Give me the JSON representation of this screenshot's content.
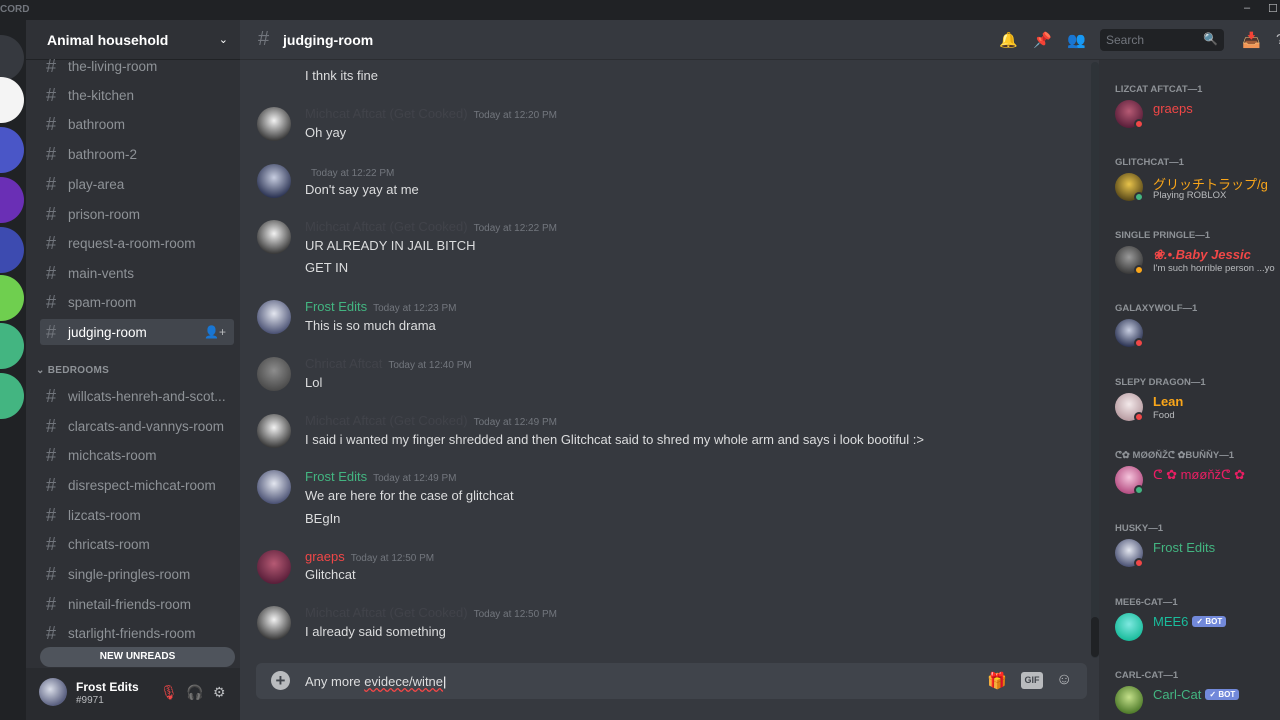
{
  "titlebar": {
    "brand": "CORD",
    "min": "–",
    "max": "☐"
  },
  "server": {
    "name": "Animal household",
    "chevron": "⌄"
  },
  "channels": [
    {
      "label": "the-living-room"
    },
    {
      "label": "the-kitchen"
    },
    {
      "label": "bathroom"
    },
    {
      "label": "bathroom-2"
    },
    {
      "label": "play-area"
    },
    {
      "label": "prison-room"
    },
    {
      "label": "request-a-room-room"
    },
    {
      "label": "main-vents"
    },
    {
      "label": "spam-room"
    },
    {
      "label": "judging-room",
      "active": true
    }
  ],
  "category": {
    "label": "BEDROOMS"
  },
  "bedrooms": [
    {
      "label": "willcats-henreh-and-scot..."
    },
    {
      "label": "clarcats-and-vannys-room"
    },
    {
      "label": "michcats-room"
    },
    {
      "label": "disrespect-michcat-room"
    },
    {
      "label": "lizcats-room"
    },
    {
      "label": "chricats-room"
    },
    {
      "label": "single-pringles-room"
    },
    {
      "label": "ninetail-friends-room"
    },
    {
      "label": "starlight-friends-room"
    }
  ],
  "new_unreads": "NEW UNREADS",
  "user": {
    "name": "Frost Edits",
    "tag": "#9971"
  },
  "header": {
    "channel": "judging-room",
    "search_placeholder": "Search"
  },
  "messages": [
    {
      "author": "",
      "time": "",
      "lines": [
        "I thnk its fine"
      ],
      "color": "#dcddde"
    },
    {
      "author": "Michcat Aftcat (Get Cooked)",
      "time": "Today at 12:20 PM",
      "lines": [
        "Oh yay"
      ],
      "color": "#41434a"
    },
    {
      "author": "",
      "time": "Today at 12:22 PM",
      "lines": [
        "Don't say yay at me"
      ],
      "color": "#41434a"
    },
    {
      "author": "Michcat Aftcat (Get Cooked)",
      "time": "Today at 12:22 PM",
      "lines": [
        "UR ALREADY IN JAIL BITCH",
        "GET IN"
      ],
      "color": "#41434a"
    },
    {
      "author": "Frost Edits",
      "time": "Today at 12:23 PM",
      "lines": [
        "This is so much drama"
      ],
      "color": "#43b581"
    },
    {
      "author": "Chricat Aftcat",
      "time": "Today at 12:40 PM",
      "lines": [
        "Lol"
      ],
      "color": "#41434a"
    },
    {
      "author": "Michcat Aftcat (Get Cooked)",
      "time": "Today at 12:49 PM",
      "lines": [
        "I said i wanted my finger shredded and then Glitchcat said to shred my whole arm and says i look bootiful :>"
      ],
      "color": "#41434a"
    },
    {
      "author": "Frost Edits",
      "time": "Today at 12:49 PM",
      "lines": [
        "We are here for the case of glitchcat",
        "BEgIn"
      ],
      "color": "#43b581"
    },
    {
      "author": "graeps",
      "time": "Today at 12:50 PM",
      "lines": [
        "Glitchcat"
      ],
      "color": "#f04747"
    },
    {
      "author": "Michcat Aftcat (Get Cooked)",
      "time": "Today at 12:50 PM",
      "lines": [
        "I already said something"
      ],
      "color": "#41434a"
    }
  ],
  "composer": {
    "value_a": "Any more ",
    "value_b": "evidece/witne",
    "gif": "GIF"
  },
  "members": [
    {
      "cat": "LIZCAT AFTCAT—1",
      "name": "graeps",
      "sub": "",
      "color": "#f04747",
      "status": "#f04747",
      "bot": ""
    },
    {
      "cat": "GLITCHCAT—1",
      "name": "グリッチトラップ/g",
      "sub": "Playing ROBLOX",
      "color": "#faa61a",
      "status": "#43b581",
      "bot": ""
    },
    {
      "cat": "SINGLE PRINGLE—1",
      "name": "❀.•.Baby Jessic",
      "sub": "I'm such horrible person ...yo",
      "color": "#f04747",
      "status": "#faa61a",
      "bot": ""
    },
    {
      "cat": "GALAXYWOLF—1",
      "name": "",
      "sub": "",
      "color": "#7289da",
      "status": "#f04747",
      "bot": ""
    },
    {
      "cat": "SLEPY DRAGON—1",
      "name": "Lean",
      "sub": "Food",
      "color": "#faa61a",
      "status": "#f04747",
      "bot": ""
    },
    {
      "cat": "ᕦ✿ MØØŇŽᕦ ✿BUŇŇY—1",
      "name": "ᕦ ✿ møøňžᕦ ✿",
      "sub": "",
      "color": "#e91e63",
      "status": "#43b581",
      "bot": ""
    },
    {
      "cat": "HUSKY—1",
      "name": "Frost Edits",
      "sub": "",
      "color": "#43b581",
      "status": "#f04747",
      "bot": ""
    },
    {
      "cat": "MEE6-CAT—1",
      "name": "MEE6",
      "sub": "",
      "color": "#1abc9c",
      "status": "",
      "bot": "✓ BOT"
    },
    {
      "cat": "CARL-CAT—1",
      "name": "Carl-Cat",
      "sub": "",
      "color": "#43b581",
      "status": "",
      "bot": "✓ BOT"
    }
  ],
  "colors": {
    "accent": "#7289da",
    "online": "#43b581",
    "dnd": "#f04747",
    "idle": "#faa61a"
  },
  "icons": [
    "bell-icon",
    "pin-icon",
    "members-icon",
    "search-icon",
    "inbox-icon",
    "gift-icon",
    "emoji-icon",
    "mute-icon",
    "deafen-icon",
    "settings-icon"
  ]
}
